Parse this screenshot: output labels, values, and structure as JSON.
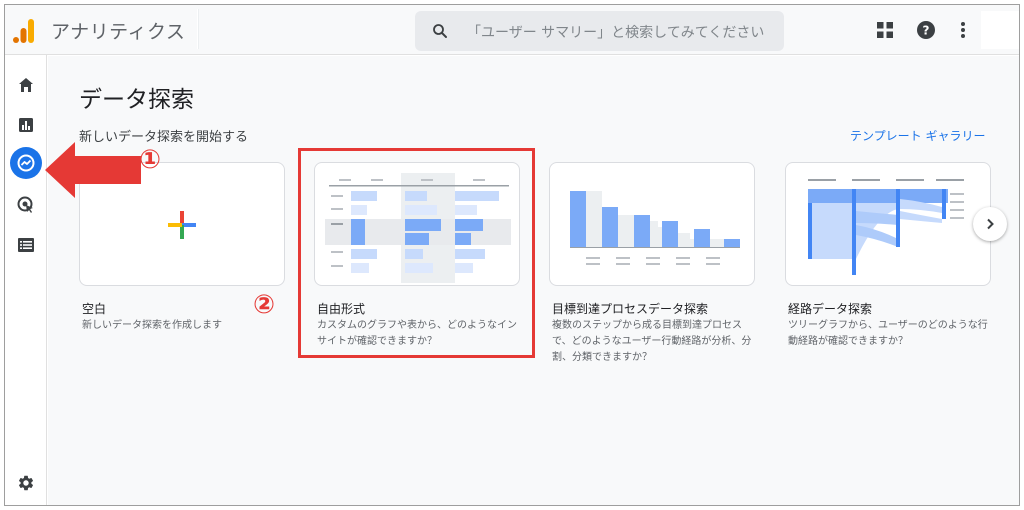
{
  "header": {
    "app_title": "アナリティクス",
    "search_placeholder": "「ユーザー サマリー」と検索してみてください"
  },
  "main": {
    "page_title": "データ探索",
    "section_label": "新しいデータ探索を開始する",
    "gallery_link": "テンプレート ギャラリー",
    "cards": [
      {
        "title": "空白",
        "description": "新しいデータ探索を作成します"
      },
      {
        "title": "自由形式",
        "description_lines": [
          "カスタムのグラフや表から、どのようなイン",
          "サイトが確認できますか？"
        ]
      },
      {
        "title": "目標到達プロセスデータ探索",
        "description_lines": [
          "複数のステップから成る目標到達プロセス",
          "で、どのようなユーザー行動経路が分析、分",
          "割、分類できますか？"
        ]
      },
      {
        "title": "経路データ探索",
        "description_lines": [
          "ツリーグラフから、ユーザーのどのような行",
          "動経路が確認できますか？"
        ]
      }
    ]
  },
  "annotations": {
    "step1": "①",
    "step2": "②"
  },
  "colors": {
    "accent_blue": "#1a73e8",
    "annotation_red": "#e53935",
    "logo_orange": "#f9ab00",
    "logo_dark_orange": "#e37400"
  },
  "icons": [
    "analytics-logo-icon",
    "search-icon",
    "apps-grid-icon",
    "help-icon",
    "more-vert-icon",
    "home-icon",
    "reports-icon",
    "explore-icon",
    "advertising-icon",
    "configure-icon",
    "settings-icon",
    "plus-icon",
    "chevron-right-icon"
  ]
}
